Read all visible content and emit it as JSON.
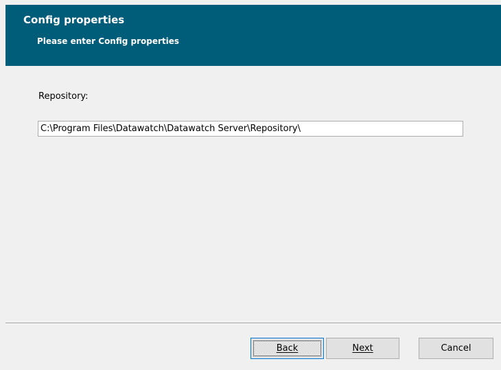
{
  "header": {
    "title": "Config properties",
    "subtitle": "Please enter Config properties"
  },
  "repository": {
    "label": "Repository:",
    "value": "C:\\Program Files\\Datawatch\\Datawatch Server\\Repository\\"
  },
  "buttons": {
    "back": "Back",
    "next": "Next",
    "cancel": "Cancel"
  },
  "colors": {
    "header_bg": "#005d7a",
    "dialog_bg": "#f0f0f0",
    "focus_border": "#0078d7"
  }
}
